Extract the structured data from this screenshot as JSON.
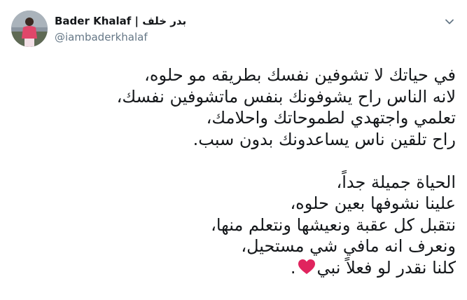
{
  "author": {
    "display_name": "Bader Khalaf | بدر خلف",
    "handle": "@iambaderkhalaf",
    "avatar_icon": "profile-photo"
  },
  "tweet": {
    "paragraph_1": [
      "في حياتك لا تشوفين نفسك بطريقه مو حلوه،",
      "لانه الناس راح يشوفونك بنفس ماتشوفين نفسك،",
      "تعلمي واجتهدي لطموحاتك واحلامك،",
      "راح تلقين ناس يساعدونك بدون سبب."
    ],
    "paragraph_2": [
      "الحياة جميلة جداً،",
      "علينا نشوفها بعين حلوه،",
      "نتقبل كل عقبة ونعيشها ونتعلم منها،",
      "ونعرف انه مافي شي مستحيل،"
    ],
    "last_line_text": "كلنا نقدر لو فعلاً نبي",
    "last_line_end": ".",
    "heart_icon": "red-heart-emoji",
    "heart_color": "#e0245e"
  },
  "menu_icon": "chevron-down-icon"
}
